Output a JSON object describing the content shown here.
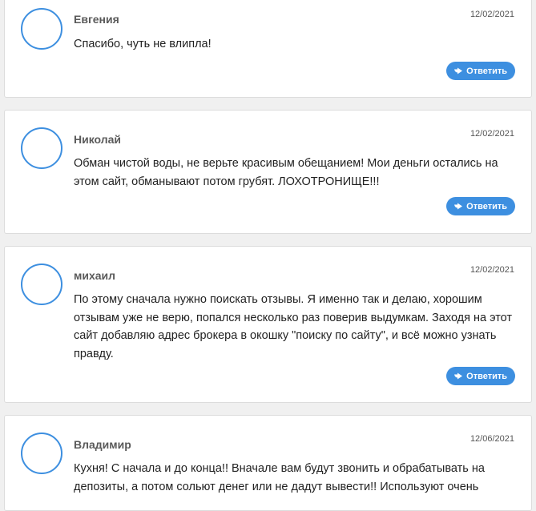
{
  "comments": [
    {
      "author": "Евгения",
      "date": "12/02/2021",
      "text": "Спасибо, чуть не влипла!",
      "reply_label": "Ответить"
    },
    {
      "author": "Николай",
      "date": "12/02/2021",
      "text": "Обман чистой воды, не верьте красивым обещанием! Мои деньги остались на этом сайт, обманывают потом грубят. ЛОХОТРОНИЩЕ!!!",
      "reply_label": "Ответить"
    },
    {
      "author": "михаил",
      "date": "12/02/2021",
      "text": "По этому сначала нужно поискать отзывы. Я именно так и делаю, хорошим отзывам уже не верю, попался несколько раз поверив выдумкам. Заходя на этот сайт добавляю адрес брокера в окошку \"поиску по сайту\", и всё можно узнать правду.",
      "reply_label": "Ответить"
    },
    {
      "author": "Владимир",
      "date": "12/06/2021",
      "text": "Кухня! С начала и до конца!! Вначале вам будут звонить и обрабатывать на депозиты, а потом сольют денег или не дадут вывести!! Используют очень",
      "reply_label": ""
    }
  ],
  "colors": {
    "accent": "#3d8fe0",
    "page_background": "#f0f0f0"
  },
  "icons": {
    "reply": "reply-arrow-icon",
    "avatar": "avatar-circle"
  }
}
